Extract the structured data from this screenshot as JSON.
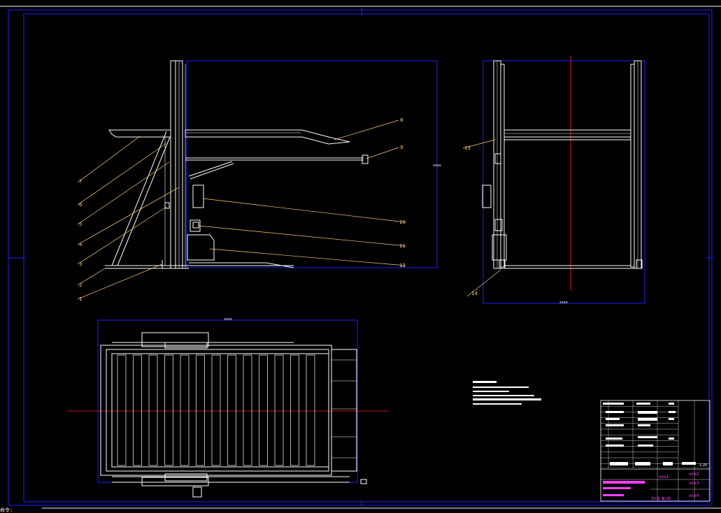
{
  "drawing": {
    "background": "#000000",
    "colors": {
      "frame": "#2020ff",
      "outline": "#ffffff",
      "leader": "#ffd27a",
      "centerline": "#ff2020",
      "titleblock_text": "#ff40ff"
    },
    "side_view": {
      "part_labels": [
        "7",
        "6",
        "5",
        "4",
        "3",
        "2",
        "1",
        "8",
        "9",
        "10",
        "11",
        "12"
      ],
      "dimension_text": "xxxx"
    },
    "end_view": {
      "part_labels": [
        "13",
        "14"
      ],
      "dimension_text": "xxxx"
    },
    "plan_view": {
      "dimension_text": "xxxx"
    },
    "title_block": {
      "drawing_numbers": [
        "xxx1",
        "xxx2",
        "xxx3",
        "xxx4"
      ],
      "sheet_text": "共1张 第1张",
      "scale_text": "1:20"
    },
    "command_line": "命令:"
  }
}
